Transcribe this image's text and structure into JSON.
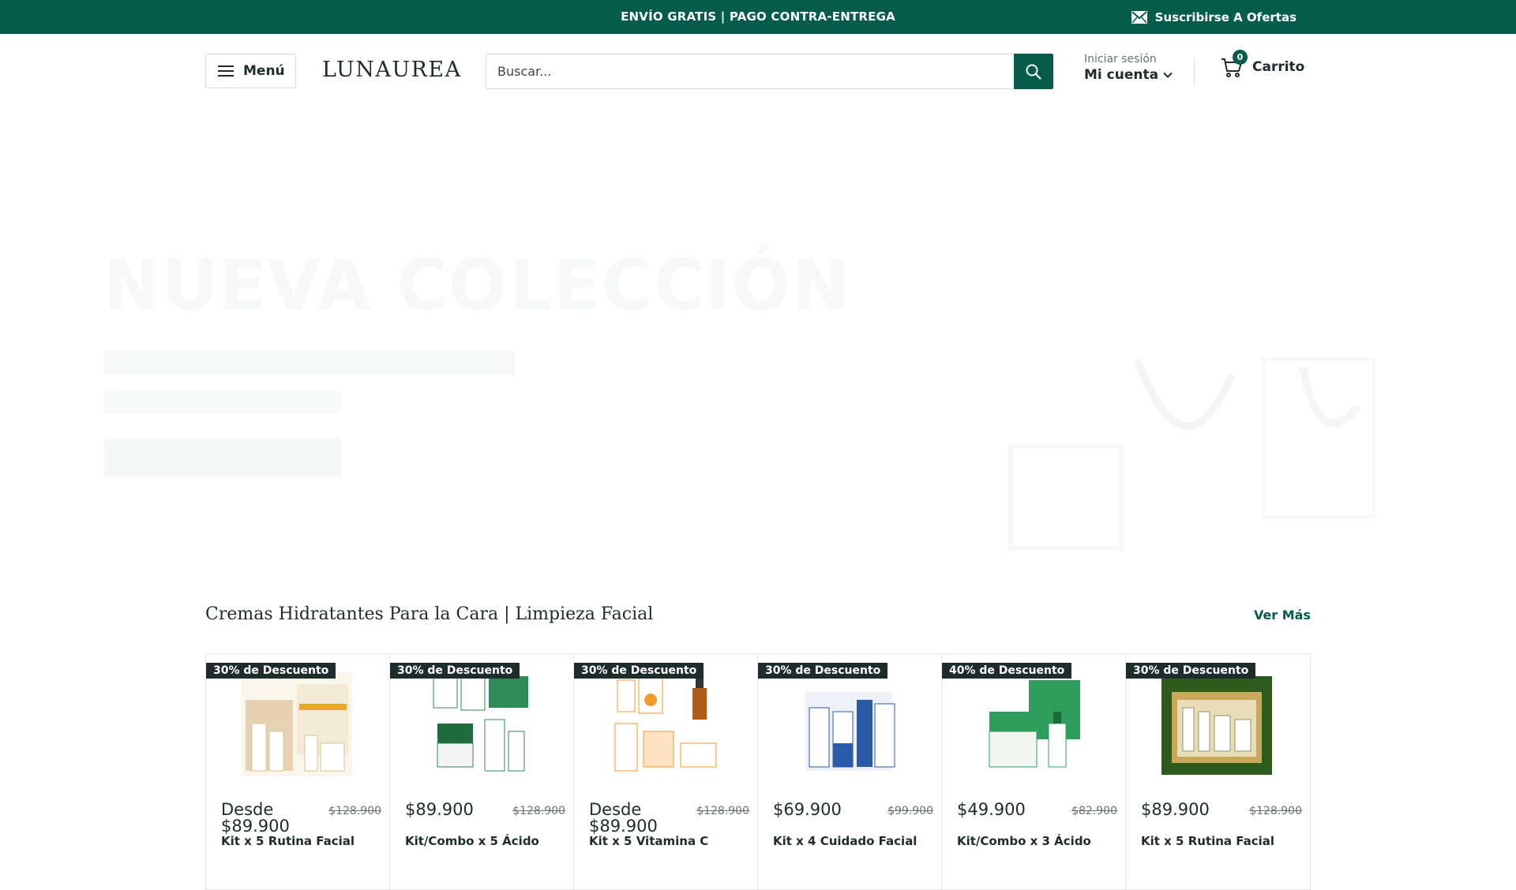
{
  "announcement": {
    "message": "ENVÍO GRATIS | PAGO CONTRA-ENTREGA",
    "newsletter_label": "Suscribirse A Ofertas"
  },
  "header": {
    "menu_label": "Menú",
    "logo": "LUNAUREA",
    "search_placeholder": "Buscar...",
    "login_label": "Iniciar sesión",
    "account_label": "Mi cuenta",
    "cart_count": "0",
    "cart_label": "Carrito"
  },
  "hero": {
    "title": "NUEVA COLECCIÓN"
  },
  "section": {
    "title": "Cremas Hidratantes Para la Cara | Limpieza Facial",
    "see_more": "Ver Más"
  },
  "products": [
    {
      "badge": "30% de Descuento",
      "price": "Desde $89.900",
      "old_price": "$128.900",
      "name": "Kit x 5 Rutina Facial",
      "theme": "#e6d2b0"
    },
    {
      "badge": "30% de Descuento",
      "price": "$89.900",
      "old_price": "$128.900",
      "name": "Kit/Combo x 5 Ácido",
      "theme": "#2e8b57"
    },
    {
      "badge": "30% de Descuento",
      "price": "Desde $89.900",
      "old_price": "$128.900",
      "name": "Kit x 5 Vitamina C",
      "theme": "#f39a2b"
    },
    {
      "badge": "30% de Descuento",
      "price": "$69.900",
      "old_price": "$99.900",
      "name": "Kit x 4 Cuidado Facial",
      "theme": "#2a5ba8"
    },
    {
      "badge": "40% de Descuento",
      "price": "$49.900",
      "old_price": "$82.900",
      "name": "Kit/Combo x 3 Ácido",
      "theme": "#2f9e5d"
    },
    {
      "badge": "30% de Descuento",
      "price": "$89.900",
      "old_price": "$128.900",
      "name": "Kit x 5 Rutina Facial",
      "theme": "#4a6b2e"
    }
  ],
  "colors": {
    "brand": "#065c4b",
    "text": "#1e2d2b",
    "badge_bg": "#1e2d2b"
  },
  "icons": [
    "envelope-icon",
    "hamburger-icon",
    "search-icon",
    "chevron-down-icon",
    "cart-icon"
  ]
}
